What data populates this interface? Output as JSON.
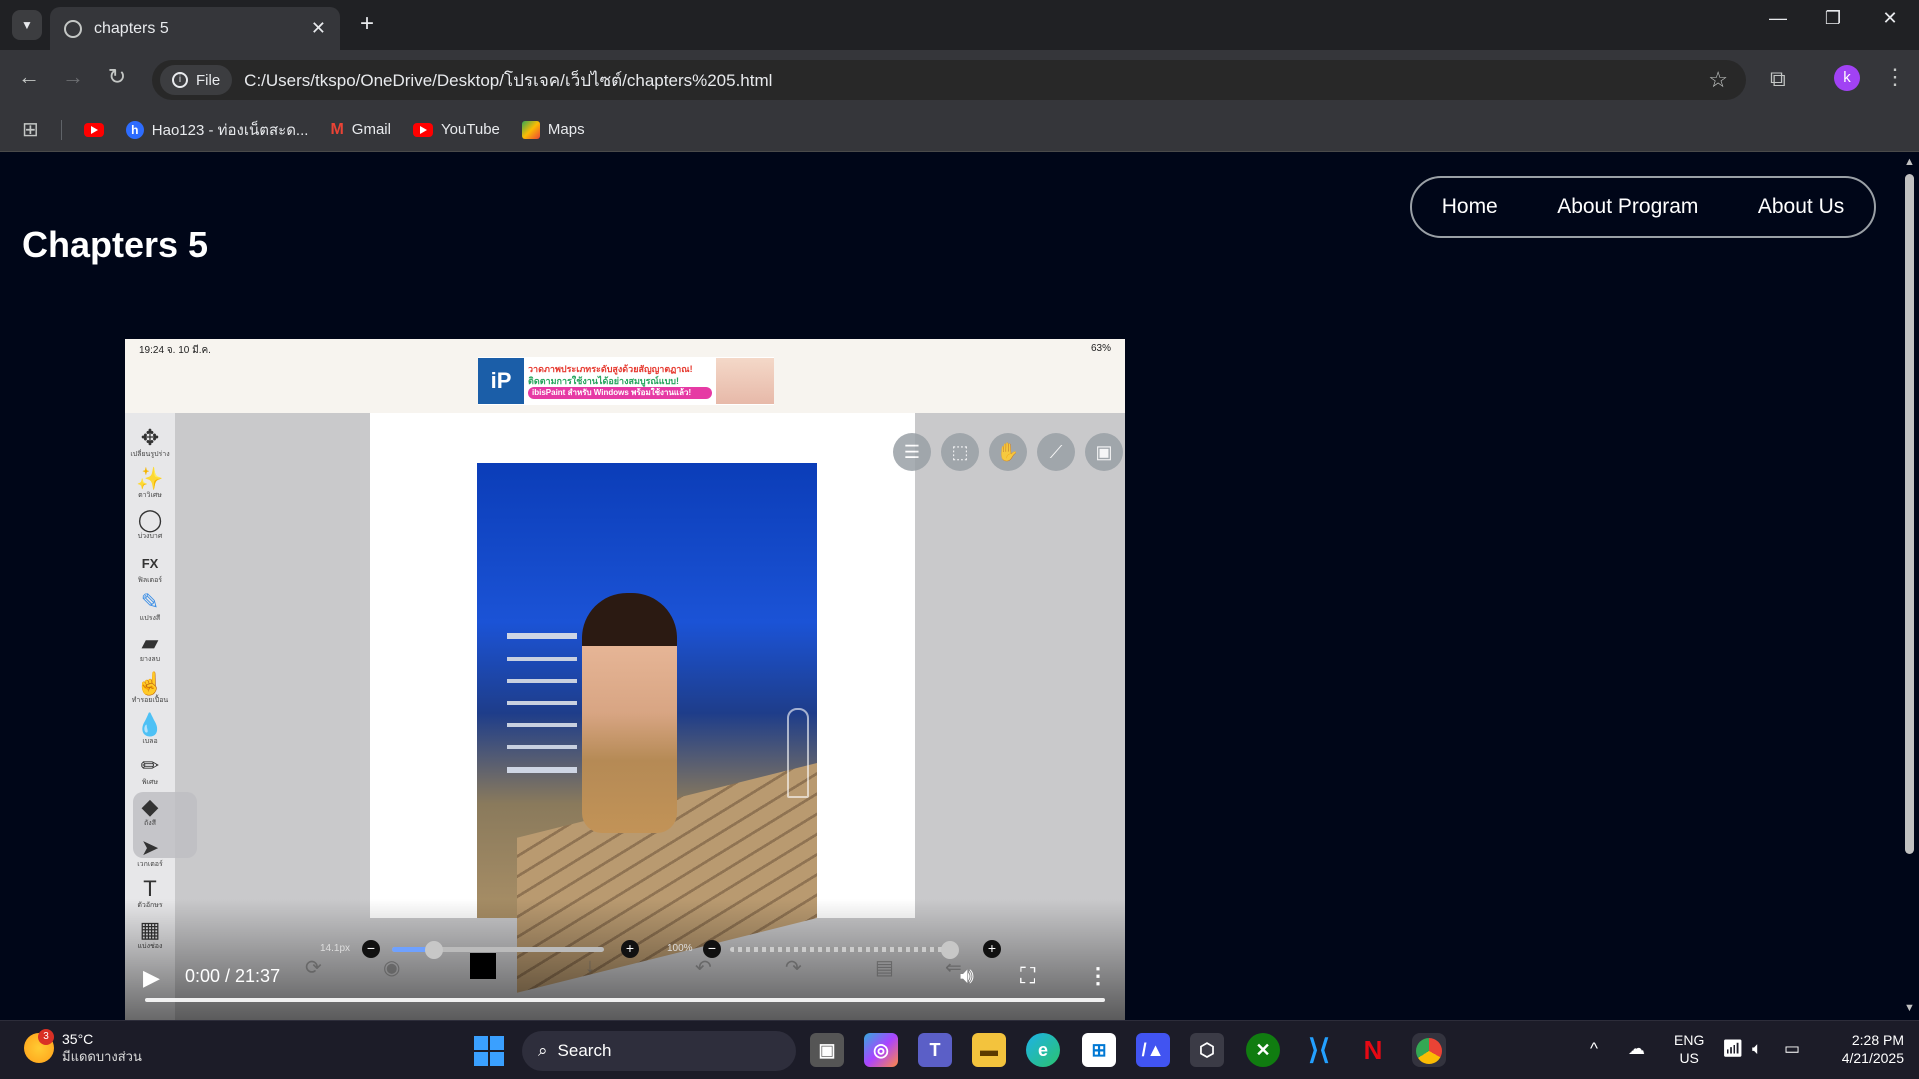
{
  "browser": {
    "tab_title": "chapters 5",
    "site_chip": "File",
    "url": "C:/Users/tkspo/OneDrive/Desktop/โปรเจค/เว็ปไซต์/chapters%205.html",
    "profile_initial": "k",
    "bookmarks": [
      {
        "label": "Hao123 - ท่องเน็ตสะด...",
        "icon": "hao123-icon"
      },
      {
        "label": "Gmail",
        "icon": "gmail-icon"
      },
      {
        "label": "YouTube",
        "icon": "youtube-icon"
      },
      {
        "label": "Maps",
        "icon": "maps-icon"
      }
    ]
  },
  "page": {
    "title": "Chapters 5",
    "nav": [
      "Home",
      "About Program",
      "About Us"
    ]
  },
  "video": {
    "ipad_time": "19:24  จ. 10 มี.ค.",
    "ipad_battery": "63%",
    "ad_line1": "วาดภาพประเภทระดับสูงด้วยสัญญาตฏาณ!",
    "ad_line2": "ติดตามการใช้งานได้อย่างสมบูรณ์แบบ!",
    "ad_line3": "ibisPaint สำหรับ Windows พร้อมใช้งานแล้ว!",
    "ad_logo": "iP",
    "tools": [
      {
        "label": "เปลี่ยนรูปร่าง",
        "icon": "move-icon",
        "glyph": "✥"
      },
      {
        "label": "ตาวิเศษ",
        "icon": "magic-wand-icon",
        "glyph": "✨"
      },
      {
        "label": "บ่วงบาศ",
        "icon": "lasso-icon",
        "glyph": "◯"
      },
      {
        "label": "ฟิลเตอร์",
        "icon": "fx-icon",
        "glyph": "FX"
      },
      {
        "label": "แปรงสี",
        "icon": "brush-icon",
        "glyph": "✎"
      },
      {
        "label": "ยางลบ",
        "icon": "eraser-icon",
        "glyph": "▰"
      },
      {
        "label": "ทำรอยเปื้อน",
        "icon": "smudge-icon",
        "glyph": "☝"
      },
      {
        "label": "เบลอ",
        "icon": "blur-icon",
        "glyph": "💧"
      },
      {
        "label": "พิเศษ",
        "icon": "special-pen-icon",
        "glyph": "✏"
      },
      {
        "label": "ถังสี",
        "icon": "fill-icon",
        "glyph": "◆"
      },
      {
        "label": "เวกเตอร์",
        "icon": "cursor-icon",
        "glyph": "➤"
      },
      {
        "label": "ตัวอักษร",
        "icon": "text-icon",
        "glyph": "T"
      },
      {
        "label": "แบ่งช่อง",
        "icon": "frame-divider-icon",
        "glyph": "▦"
      }
    ],
    "brush_size": "14.1px",
    "brush_size_fraction": 0.2,
    "opacity": "100%",
    "opacity_fraction": 1.0,
    "time_display": "0:00 / 21:37",
    "progress_fraction": 0
  },
  "taskbar": {
    "temperature": "35°C",
    "weather_desc": "มีแดดบางส่วน",
    "weather_badge": "3",
    "search_label": "Search",
    "lang_top": "ENG",
    "lang_bottom": "US",
    "clock_time": "2:28 PM",
    "clock_date": "4/21/2025"
  }
}
